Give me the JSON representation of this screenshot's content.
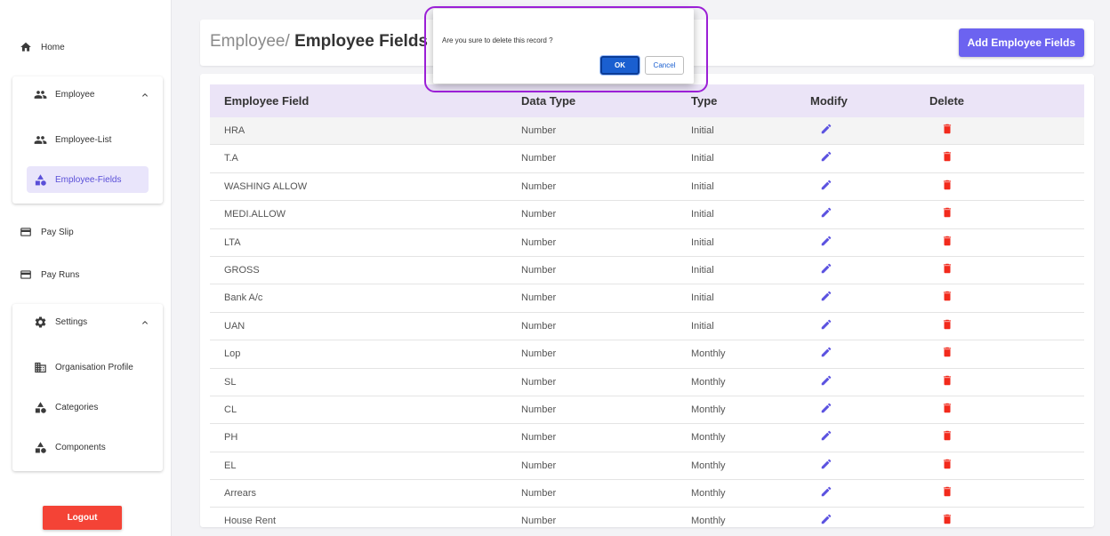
{
  "sidebar": {
    "home": "Home",
    "employee_group": {
      "label": "Employee",
      "items": [
        "Employee-List",
        "Employee-Fields"
      ]
    },
    "pay_slip": "Pay Slip",
    "pay_runs": "Pay Runs",
    "settings_group": {
      "label": "Settings",
      "items": [
        "Organisation Profile",
        "Categories",
        "Components"
      ]
    },
    "logout": "Logout"
  },
  "header": {
    "crumb_parent": "Employee/",
    "crumb_current": "Employee Fields",
    "add_button": "Add Employee Fields"
  },
  "table": {
    "columns": [
      "Employee Field",
      "Data Type",
      "Type",
      "Modify",
      "Delete"
    ],
    "rows": [
      {
        "field": "HRA",
        "data_type": "Number",
        "type": "Initial"
      },
      {
        "field": "T.A",
        "data_type": "Number",
        "type": "Initial"
      },
      {
        "field": "WASHING ALLOW",
        "data_type": "Number",
        "type": "Initial"
      },
      {
        "field": "MEDI.ALLOW",
        "data_type": "Number",
        "type": "Initial"
      },
      {
        "field": "LTA",
        "data_type": "Number",
        "type": "Initial"
      },
      {
        "field": "GROSS",
        "data_type": "Number",
        "type": "Initial"
      },
      {
        "field": "Bank A/c",
        "data_type": "Number",
        "type": "Initial"
      },
      {
        "field": "UAN",
        "data_type": "Number",
        "type": "Initial"
      },
      {
        "field": "Lop",
        "data_type": "Number",
        "type": "Monthly"
      },
      {
        "field": "SL",
        "data_type": "Number",
        "type": "Monthly"
      },
      {
        "field": "CL",
        "data_type": "Number",
        "type": "Monthly"
      },
      {
        "field": "PH",
        "data_type": "Number",
        "type": "Monthly"
      },
      {
        "field": "EL",
        "data_type": "Number",
        "type": "Monthly"
      },
      {
        "field": "Arrears",
        "data_type": "Number",
        "type": "Monthly"
      },
      {
        "field": "House Rent",
        "data_type": "Number",
        "type": "Monthly"
      }
    ]
  },
  "dialog": {
    "message": "Are you sure to delete this record ?",
    "ok": "OK",
    "cancel": "Cancel"
  },
  "icons": {
    "home": "home-icon",
    "employee": "people-icon",
    "fields": "shapes-icon",
    "pay": "credit-card-icon",
    "settings": "gear-icon",
    "organisation": "building-icon",
    "edit": "pencil-icon",
    "delete": "trash-icon"
  },
  "colors": {
    "accent": "#6c63f0",
    "active_bg": "#e9e5fb",
    "header_bg": "#ebe4f7",
    "danger": "#f44336",
    "ok_button": "#1a5fd0",
    "highlight_ring": "#9b1fd6"
  }
}
